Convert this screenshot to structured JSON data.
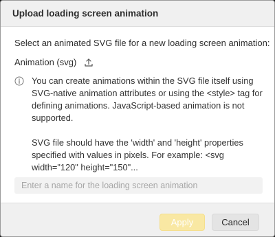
{
  "dialog": {
    "title": "Upload loading screen animation",
    "intro": "Select an animated SVG file for a new loading screen animation:",
    "file_label": "Animation (svg)",
    "upload_icon": "upload-icon",
    "info_icon": "info-icon",
    "info_paragraphs": [
      "You can create animations within the SVG file itself using SVG-native animation attributes or using the <style> tag for defining animations. JavaScript-based animation is not supported.",
      "SVG file should have the 'width' and 'height' properties specified with values in pixels. For example: <svg width=\"120\" height=\"150\"..."
    ],
    "name_input": {
      "value": "",
      "placeholder": "Enter a name for the loading screen animation"
    },
    "buttons": {
      "apply": "Apply",
      "cancel": "Cancel"
    }
  },
  "colors": {
    "header_bg": "#f0f0f0",
    "apply_bg": "#f9e8a3",
    "cancel_bg": "#e4e4e4",
    "input_bg": "#f2f2f2"
  }
}
